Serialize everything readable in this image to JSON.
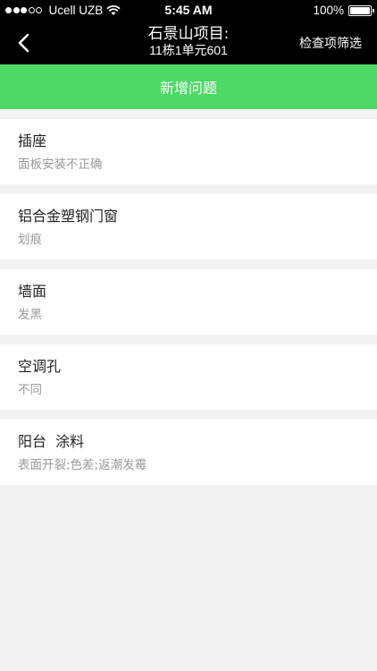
{
  "status_bar": {
    "carrier": "Ucell UZB",
    "time": "5:45 AM",
    "battery": "100%",
    "signal_bars": 3,
    "signal_max": 5
  },
  "nav": {
    "title_line1": "石景山项目:",
    "title_line2": "11栋1单元601",
    "filter_label": "检查项筛选"
  },
  "add_issue_label": "新增问题",
  "issues": [
    {
      "title": "插座",
      "detail": "面板安装不正确"
    },
    {
      "title": "铝合金塑钢门窗",
      "detail": "划痕"
    },
    {
      "title": "墙面",
      "detail": "发黑"
    },
    {
      "title": "空调孔",
      "detail": "不同"
    },
    {
      "title": "阳台  涂料",
      "detail": "表面开裂;色差;返潮发霉"
    }
  ],
  "colors": {
    "accent_green": "#4cd964",
    "nav_background": "#000000",
    "page_background": "#f2f2f2"
  }
}
